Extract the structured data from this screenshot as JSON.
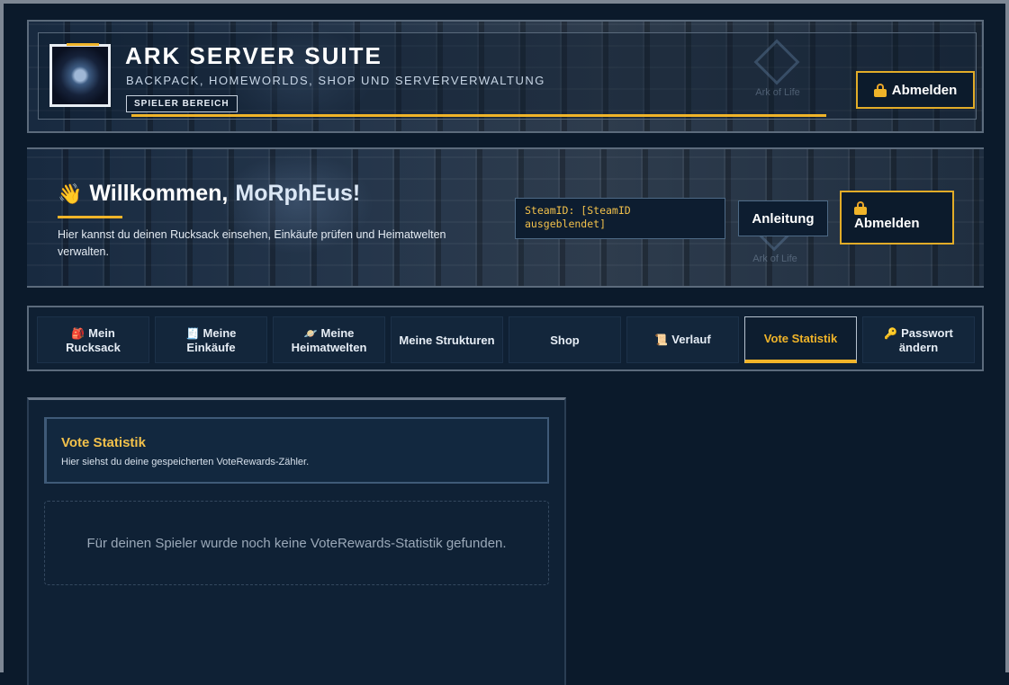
{
  "header": {
    "title": "ARK SERVER SUITE",
    "subtitle": "BACKPACK, HOMEWORLDS, SHOP UND SERVERVERWALTUNG",
    "badge": "SPIELER BEREICH",
    "logout_label": "Abmelden",
    "watermark": "Ark of Life"
  },
  "welcome": {
    "greeting": "Willkommen,",
    "username": "MoRphEus!",
    "wave_icon": "👋",
    "description": "Hier kannst du deinen Rucksack einsehen, Einkäufe prüfen und Heimatwelten verwalten.",
    "steamid": "SteamID: [SteamID ausgeblendet]",
    "guide_label": "Anleitung",
    "logout_label": "Abmelden",
    "watermark": "Ark of Life"
  },
  "nav": {
    "tabs": [
      {
        "icon": "🎒",
        "label": "Mein Rucksack"
      },
      {
        "icon": "🧾",
        "label": "Meine Einkäufe"
      },
      {
        "icon": "🪐",
        "label": "Meine Heimatwelten"
      },
      {
        "icon": "",
        "label": "Meine Strukturen"
      },
      {
        "icon": "",
        "label": "Shop"
      },
      {
        "icon": "📜",
        "label": "Verlauf"
      },
      {
        "icon": "",
        "label": "Vote Statistik"
      },
      {
        "icon": "🔑",
        "label": "Passwort ändern"
      }
    ],
    "active": "Vote Statistik"
  },
  "vote": {
    "title": "Vote Statistik",
    "subtitle": "Hier siehst du deine gespeicherten VoteRewards-Zähler.",
    "empty_message": "Für deinen Spieler wurde noch keine VoteRewards-Statistik gefunden."
  },
  "colors": {
    "accent": "#f0b429",
    "background": "#0b1a2b",
    "panel": "#13263b"
  }
}
